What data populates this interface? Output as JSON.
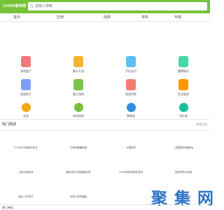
{
  "header": {
    "logo": "125ID游戏网",
    "search_placeholder": "请输入搜索"
  },
  "nav": [
    "首页",
    "应用",
    "网游",
    "单机",
    "专题"
  ],
  "apps": [
    {
      "label": "游戏盒子",
      "color": "#f07878"
    },
    {
      "label": "聚乐天游",
      "color": "#f7b233"
    },
    {
      "label": "手机宝贝",
      "color": "#5bbff0"
    },
    {
      "label": "魔界精灵",
      "color": "#47d6a8"
    },
    {
      "label": "游戏助手",
      "color": "#7f9ff6"
    },
    {
      "label": "看大游戏",
      "color": "#7bc24a"
    },
    {
      "label": "是游世界",
      "color": "#f27d70"
    },
    {
      "label": "生活服务",
      "color": "#ff9900"
    }
  ],
  "categories": [
    {
      "label": "全部",
      "color": "#f4a818"
    },
    {
      "label": "休闲游戏",
      "color": "#79c03f"
    },
    {
      "label": "策略类",
      "color": "#2f8ee0"
    },
    {
      "label": "动作类",
      "color": "#17bf9a"
    }
  ],
  "hot": {
    "title": "热门网游",
    "more": "查看全部",
    "rows": [
      [
        "2024红手指助手官方",
        "江湖风暴最新版",
        "大唐风华",
        "三国群英传最新版"
      ],
      [
        "火影忍者游戏",
        "暴走官方正版魔兽世界",
        "2024新游戏首发游戏",
        "剑侠世界手游版"
      ],
      [
        "魔法少年官方",
        "永恒之塔完整版",
        "",
        "梦幻诛仙正版"
      ]
    ]
  },
  "watermark": "聚 集 网",
  "bottom_title": "热门单机"
}
